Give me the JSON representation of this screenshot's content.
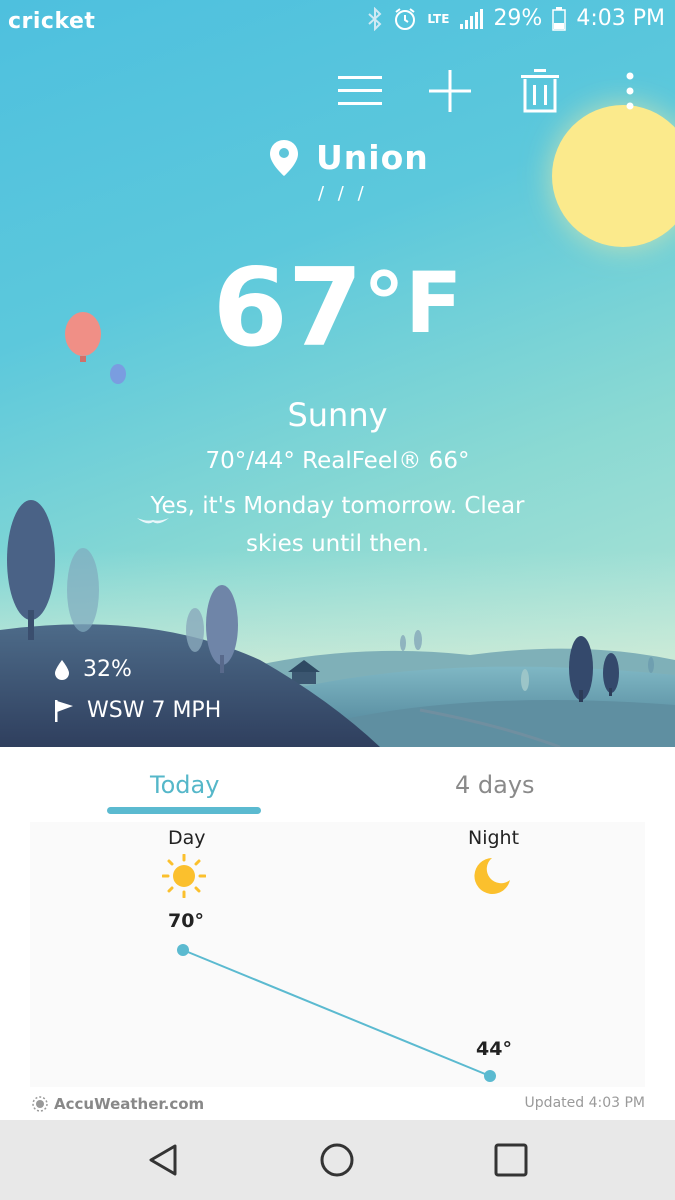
{
  "status_bar": {
    "carrier": "cricket",
    "network": "LTE",
    "battery": "29%",
    "time": "4:03 PM",
    "icons": [
      "bluetooth-icon",
      "alarm-icon",
      "lte-icon",
      "signal-icon",
      "battery-icon"
    ]
  },
  "toolbar": {
    "icons": [
      "menu-icon",
      "add-icon",
      "delete-icon",
      "more-icon"
    ]
  },
  "location": {
    "name": "Union",
    "page_indicator": "/ / /"
  },
  "current": {
    "temperature": "67",
    "unit": "°F",
    "condition": "Sunny",
    "hi_lo_realfeel": "70°/44° RealFeel® 66°",
    "description": "Yes, it's Monday tomorrow. Clear skies until then.",
    "humidity": "32%",
    "wind": "WSW 7 MPH"
  },
  "tabs": {
    "today": "Today",
    "four_days": "4 days",
    "selected": "today"
  },
  "forecast": {
    "day_label": "Day",
    "night_label": "Night",
    "day_temp_label": "70°",
    "night_temp_label": "44°",
    "day_icon": "sun-icon",
    "night_icon": "moon-icon"
  },
  "chart_data": {
    "type": "line",
    "categories": [
      "Day",
      "Night"
    ],
    "values": [
      70,
      44
    ],
    "ylim": [
      44,
      70
    ]
  },
  "footer": {
    "brand": "AccuWeather.com",
    "updated": "Updated 4:03 PM"
  },
  "colors": {
    "accent": "#5bbad0",
    "sun_yellow": "#fbc02d",
    "sky_top": "#4ec0de"
  },
  "navbar": {
    "icons": [
      "back-icon",
      "home-icon",
      "recents-icon"
    ]
  }
}
